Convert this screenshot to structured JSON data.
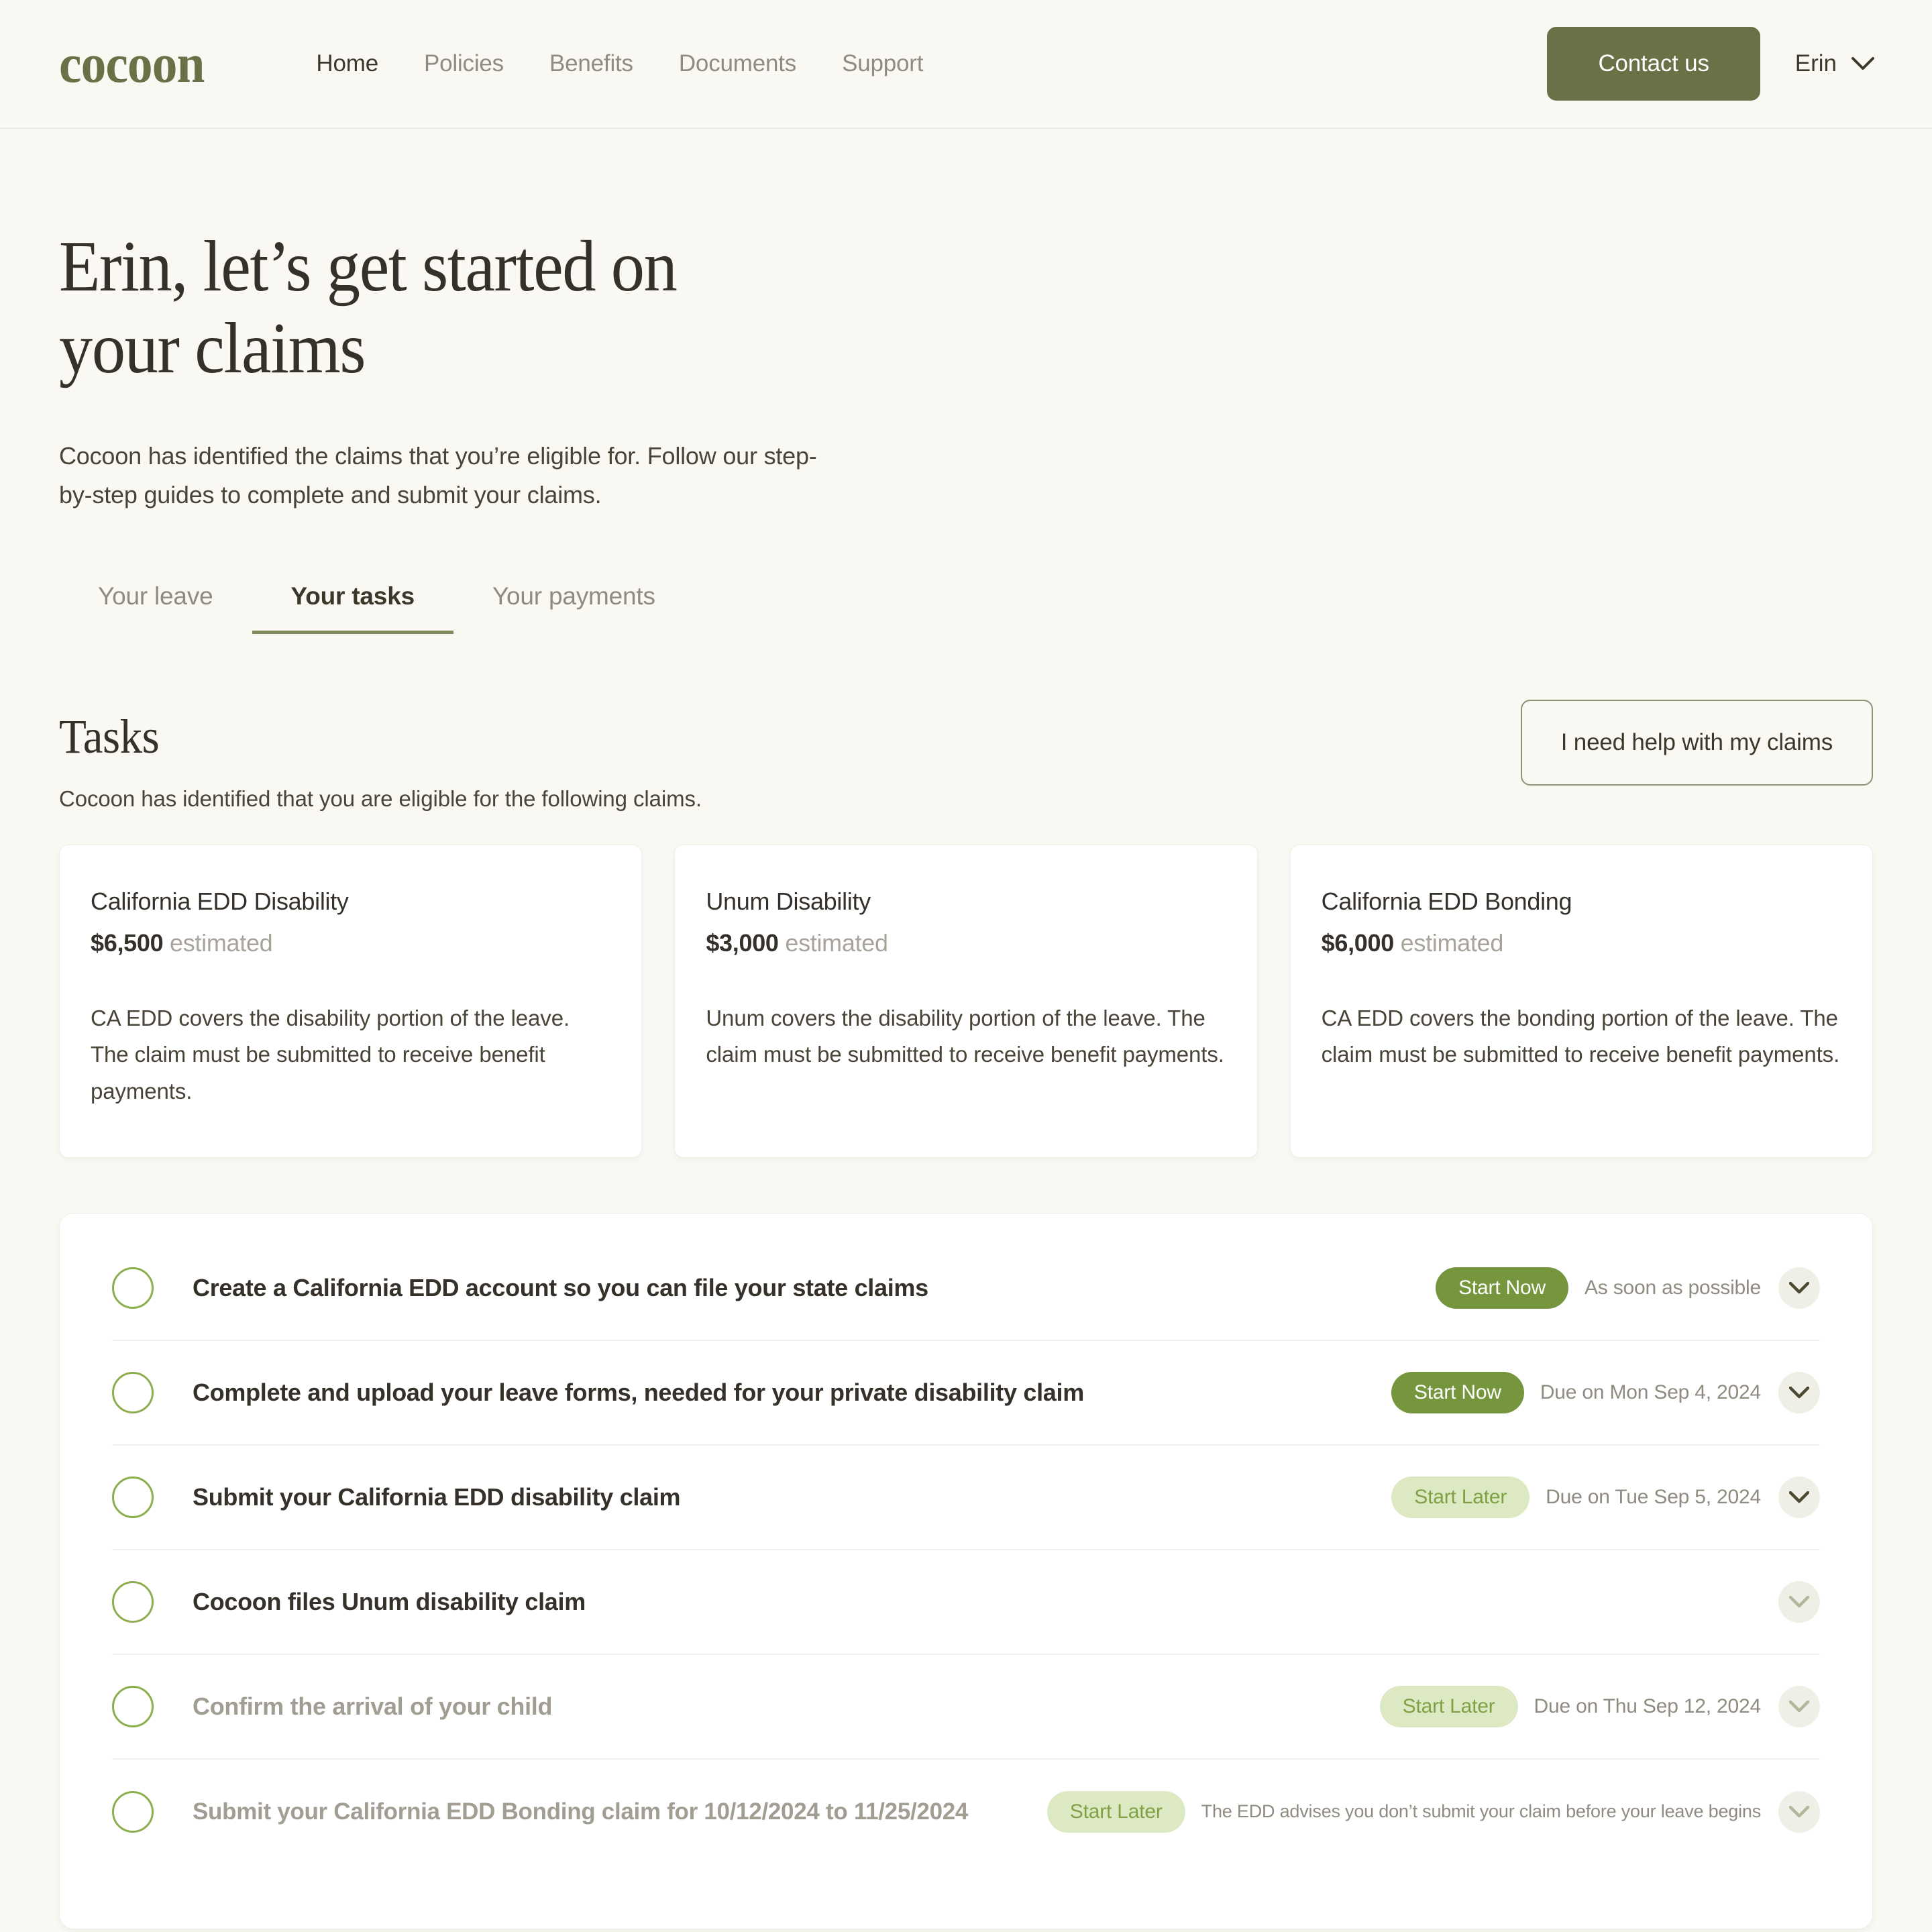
{
  "brand": {
    "logo_text": "cocoon",
    "accent_olive": "#6B7047",
    "accent_green": "#75963C",
    "badge_later_bg": "#DDE9C3"
  },
  "header": {
    "nav": [
      {
        "label": "Home",
        "active": true
      },
      {
        "label": "Policies",
        "active": false
      },
      {
        "label": "Benefits",
        "active": false
      },
      {
        "label": "Documents",
        "active": false
      },
      {
        "label": "Support",
        "active": false
      }
    ],
    "contact_button": "Contact us",
    "user_name": "Erin",
    "user_chevron_icon": "chevron-down-icon"
  },
  "page": {
    "title": "Erin, let’s get started on your claims",
    "lede": "Cocoon has identified the claims that you’re eligible for. Follow our step-by-step guides to complete and submit your claims."
  },
  "tabs": [
    {
      "label": "Your leave",
      "active": false
    },
    {
      "label": "Your tasks",
      "active": true
    },
    {
      "label": "Your payments",
      "active": false
    }
  ],
  "tasks_section": {
    "heading": "Tasks",
    "subheading": "Cocoon has identified that you are eligible for the following claims.",
    "help_button": "I need help with my claims"
  },
  "claims": [
    {
      "name": "California EDD Disability",
      "amount": "$6,500",
      "amount_note": "estimated",
      "description": "CA EDD covers the disability portion of the leave. The claim must be submitted to receive benefit payments."
    },
    {
      "name": "Unum Disability",
      "amount": "$3,000",
      "amount_note": "estimated",
      "description": "Unum covers the disability portion of the leave. The claim must be submitted to receive benefit payments."
    },
    {
      "name": "California EDD Bonding",
      "amount": "$6,000",
      "amount_note": "estimated",
      "description": "CA EDD covers the bonding portion of the leave. The claim must be submitted to receive benefit payments."
    }
  ],
  "task_list": [
    {
      "label": "Create a California EDD account so you can file your state claims",
      "badge": "Start Now",
      "badge_kind": "now",
      "due": "As soon as possible",
      "expand_icon": "chevron-down-icon"
    },
    {
      "label": "Complete and upload your leave forms, needed for your private disability claim",
      "badge": "Start Now",
      "badge_kind": "now",
      "due": "Due on Mon Sep 4, 2024",
      "expand_icon": "chevron-down-icon"
    },
    {
      "label": "Submit your California EDD disability claim",
      "badge": "Start Later",
      "badge_kind": "later",
      "due": "Due on Tue Sep 5, 2024",
      "expand_icon": "chevron-down-icon"
    },
    {
      "label": "Cocoon files Unum disability claim",
      "badge": "",
      "badge_kind": "none",
      "due": "",
      "expand_icon": "chevron-down-icon"
    },
    {
      "label": "Confirm the arrival of your child",
      "badge": "Start Later",
      "badge_kind": "later",
      "due": "Due on Thu Sep 12, 2024",
      "expand_icon": "chevron-down-icon"
    },
    {
      "label": "Submit your California EDD Bonding claim for 10/12/2024 to 11/25/2024",
      "badge": "Start Later",
      "badge_kind": "later",
      "due": "The EDD advises you don’t submit your claim before your leave begins",
      "expand_icon": "chevron-down-icon"
    }
  ]
}
